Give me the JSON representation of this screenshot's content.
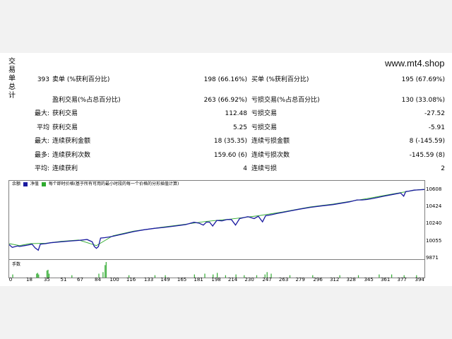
{
  "side_label": [
    "交",
    "易",
    "单",
    "总",
    "计"
  ],
  "site": "www.mt4.shop",
  "stats": {
    "rows": [
      {
        "y": 0,
        "l_label": "卖单 (%获利百分比)",
        "l_prefix": "393",
        "l_value": "198 (66.16%)",
        "r_label": "买单 (%获利百分比)",
        "r_value": "195 (67.69%)"
      },
      {
        "y": 1,
        "l_label": "盈利交易(%占总百分比)",
        "l_prefix": "",
        "l_value": "263 (66.92%)",
        "r_label": "亏损交易(%占总百分比)",
        "r_value": "130 (33.08%)"
      },
      {
        "y": 2,
        "l_label": "获利交易",
        "l_prefix": "最大:",
        "l_value": "112.48",
        "r_label": "亏损交易",
        "r_value": "-27.52"
      },
      {
        "y": 3,
        "l_label": "获利交易",
        "l_prefix": "平均",
        "l_value": "5.25",
        "r_label": "亏损交易",
        "r_value": "-5.91"
      },
      {
        "y": 4,
        "l_label": "连续获利金额",
        "l_prefix": "最大:",
        "l_value": "18 (35.35)",
        "r_label": "连续亏损金额",
        "r_value": "8 (-145.59)"
      },
      {
        "y": 5,
        "l_label": "连续获利次数",
        "l_prefix": "最多:",
        "l_value": "159.60 (6)",
        "r_label": "连续亏损次数",
        "r_value": "-145.59 (8)"
      },
      {
        "y": 6,
        "l_label": "连续获利",
        "l_prefix": "平均:",
        "l_value": "4",
        "r_label": "连续亏损",
        "r_value": "2"
      }
    ]
  },
  "chart": {
    "legend_balance": "余额",
    "legend_equity": "净值",
    "legend_text": "每个即时价格(基于所有可用的最小时段的每一个价格的分形插值计算)",
    "balance_color": "#1a1aa0",
    "equity_color": "#2eaa2e",
    "volume_label": "手数",
    "volume_color": "#2eaa2e"
  },
  "chart_data": {
    "type": "line",
    "title": "",
    "yticks": [
      9871,
      10055,
      10240,
      10424,
      10608
    ],
    "ylim": [
      9871,
      10660
    ],
    "xticks": [
      0,
      18,
      35,
      51,
      67,
      84,
      100,
      116,
      133,
      149,
      165,
      181,
      198,
      214,
      230,
      247,
      263,
      279,
      296,
      312,
      328,
      345,
      361,
      377,
      394
    ],
    "xlim": [
      0,
      400
    ],
    "series": [
      {
        "name": "余额",
        "x": [
          0,
          3,
          8,
          10,
          15,
          18,
          22,
          25,
          28,
          30,
          35,
          40,
          50,
          60,
          67,
          75,
          80,
          82,
          84,
          86,
          88,
          92,
          96,
          100,
          110,
          120,
          130,
          140,
          149,
          160,
          170,
          178,
          183,
          187,
          190,
          193,
          196,
          200,
          205,
          210,
          214,
          218,
          222,
          230,
          236,
          240,
          244,
          247,
          252,
          258,
          263,
          270,
          279,
          290,
          300,
          312,
          328,
          335,
          340,
          345,
          350,
          361,
          370,
          377,
          380,
          382,
          385,
          390,
          394,
          400
        ],
        "values": [
          10020,
          9990,
          10005,
          10000,
          10010,
          10015,
          10025,
          9985,
          9960,
          10025,
          10030,
          10040,
          10050,
          10060,
          10065,
          10075,
          10050,
          10000,
          9980,
          10000,
          10090,
          10095,
          10102,
          10110,
          10135,
          10160,
          10180,
          10195,
          10205,
          10220,
          10235,
          10260,
          10250,
          10230,
          10262,
          10262,
          10220,
          10280,
          10275,
          10290,
          10290,
          10230,
          10300,
          10320,
          10300,
          10325,
          10265,
          10330,
          10340,
          10355,
          10365,
          10380,
          10400,
          10420,
          10435,
          10450,
          10480,
          10500,
          10500,
          10505,
          10515,
          10540,
          10560,
          10575,
          10540,
          10590,
          10595,
          10605,
          10608,
          10612
        ]
      },
      {
        "name": "净值",
        "x": [
          0,
          10,
          20,
          35,
          50,
          67,
          84,
          100,
          120,
          149,
          170,
          190,
          214,
          240,
          263,
          290,
          312,
          345,
          370,
          394,
          400
        ],
        "values": [
          10030,
          10010,
          10030,
          10035,
          10055,
          10070,
          10010,
          10115,
          10165,
          10210,
          10240,
          10270,
          10295,
          10330,
          10370,
          10425,
          10455,
          10515,
          10565,
          10610,
          10614
        ]
      }
    ],
    "volume": {
      "x": [
        3,
        26,
        27,
        28,
        36,
        37,
        38,
        60,
        86,
        90,
        92,
        93,
        115,
        140,
        150,
        178,
        188,
        196,
        200,
        208,
        218,
        226,
        238,
        246,
        248,
        252,
        270,
        292,
        318,
        336,
        356,
        368,
        380,
        392
      ],
      "values": [
        0.4,
        0.5,
        0.6,
        0.4,
        0.9,
        1.0,
        0.5,
        0.3,
        0.5,
        0.7,
        1.6,
        2.0,
        0.3,
        0.3,
        0.3,
        0.4,
        0.5,
        0.4,
        0.6,
        0.3,
        0.4,
        0.3,
        0.3,
        0.4,
        0.7,
        0.5,
        0.3,
        0.3,
        0.3,
        0.3,
        0.4,
        0.4,
        0.3,
        0.3
      ],
      "ylim": [
        0,
        2
      ]
    }
  }
}
